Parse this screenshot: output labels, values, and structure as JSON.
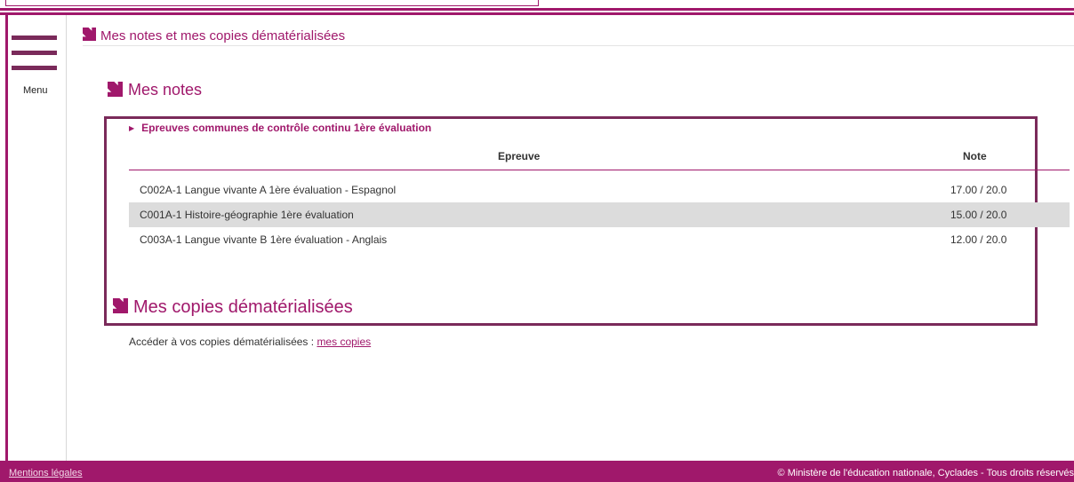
{
  "sidebar": {
    "menu_label": "Menu"
  },
  "header": {
    "title": "Mes notes et mes copies dématérialisées"
  },
  "notes": {
    "title": "Mes notes",
    "group_label": "Epreuves communes de contrôle continu 1ère évaluation",
    "columns": [
      "Epreuve",
      "Note"
    ],
    "rows": [
      {
        "epreuve": "C002A-1 Langue vivante A 1ère évaluation - Espagnol",
        "note": "17.00 / 20.0"
      },
      {
        "epreuve": "C001A-1 Histoire-géographie 1ère évaluation",
        "note": "15.00 / 20.0"
      },
      {
        "epreuve": "C003A-1 Langue vivante B 1ère évaluation - Anglais",
        "note": "12.00 / 20.0"
      }
    ]
  },
  "copies": {
    "title": "Mes copies dématérialisées",
    "text": "Accéder à vos copies dématérialisées : ",
    "link": "mes copies"
  },
  "footer": {
    "legal": "Mentions légales",
    "copyright": "© Ministère de l'éducation nationale, Cyclades - Tous droits réservés"
  },
  "colors": {
    "brand": "#a0186b",
    "menu_bar": "#7a2a5a",
    "row_alt": "#dcdcdc"
  },
  "icons": {
    "section": "corner-arrow-icon",
    "menu": "hamburger-icon",
    "group": "caret-right-icon"
  }
}
